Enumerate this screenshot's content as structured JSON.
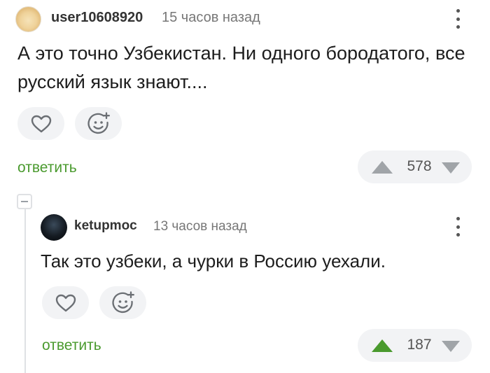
{
  "comments": [
    {
      "username": "user10608920",
      "time": "15 часов назад",
      "text": "А это точно Узбекистан. Ни одного бородатого, все русский язык знают....",
      "reply_label": "ответить",
      "rating": "578",
      "upvoted": false
    },
    {
      "username": "ketupmoc",
      "time": "13 часов назад",
      "text": "Так это узбеки, а чурки в Россию уехали.",
      "reply_label": "ответить",
      "rating": "187",
      "upvoted": true
    }
  ],
  "colors": {
    "accent_green": "#4a9a2e",
    "arrow_inactive": "#a0a4a8",
    "pill_bg": "#f2f3f5"
  },
  "icons": [
    "more-icon",
    "heart-icon",
    "add-reaction-icon",
    "upvote-icon",
    "downvote-icon",
    "collapse-icon"
  ]
}
